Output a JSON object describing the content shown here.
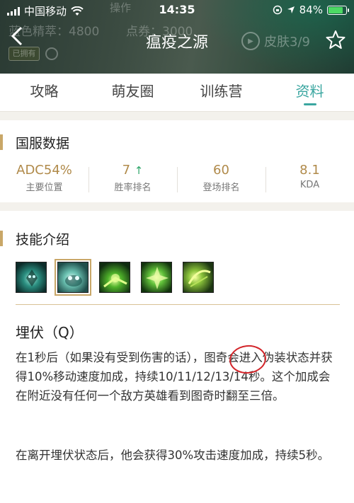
{
  "status_bar": {
    "carrier": "中国移动",
    "time": "14:35",
    "battery_percent": "84%",
    "battery_level": 0.84
  },
  "header_bg": {
    "text_left": "蓝色精萃：4800",
    "text_coupon": "点券：3000",
    "text_op": "操作"
  },
  "nav": {
    "title": "瘟疫之源",
    "skin_label": "皮肤3/9"
  },
  "tabs": [
    {
      "label": "攻略"
    },
    {
      "label": "萌友圈"
    },
    {
      "label": "训练营"
    },
    {
      "label": "资料",
      "active": true
    }
  ],
  "server_data": {
    "title": "国服数据",
    "stats": [
      {
        "value": "ADC54%",
        "label": "主要位置"
      },
      {
        "value": "7",
        "arrow": "↑",
        "label": "胜率排名"
      },
      {
        "value": "60",
        "label": "登场排名"
      },
      {
        "value": "8.1",
        "label": "KDA"
      }
    ]
  },
  "skills": {
    "title": "技能介绍",
    "icons": [
      "passive-skill-icon",
      "q-skill-icon",
      "w-skill-icon",
      "e-skill-icon",
      "r-skill-icon"
    ],
    "selected_index": 1,
    "selected_name": "埋伏（Q）",
    "description_1_pre": "在1秒后（如果没有受到伤害的话），",
    "description_1_highlight": "图奇",
    "description_1_post": "会进入伪装状态并获得10%移动速度加成，持续10/11/12/13/14秒。这个加成会在附近没有任何一个敌方英雄看到图奇时翻至三倍。",
    "description_2": "在离开埋伏状态后，他会获得30%攻击速度加成，持续5秒。"
  },
  "colors": {
    "accent": "#3aa6a0",
    "gold": "#c9a768",
    "annotation": "#d3252a"
  }
}
